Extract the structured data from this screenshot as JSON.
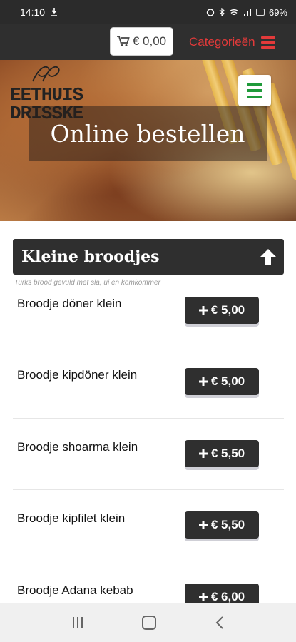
{
  "status_bar": {
    "time": "14:10",
    "battery": "69%"
  },
  "header": {
    "cart_total": "€ 0,00",
    "categories_label": "Categorieën"
  },
  "hero": {
    "logo_line1": "EETHUIS",
    "logo_line2": "DRISSKE",
    "title": "Online bestellen"
  },
  "section": {
    "title": "Kleine broodjes",
    "description": "Turks brood gevuld met sla, ui en komkommer",
    "products": [
      {
        "name": "Broodje döner klein",
        "price": "€ 5,00"
      },
      {
        "name": "Broodje kipdöner klein",
        "price": "€ 5,00"
      },
      {
        "name": "Broodje shoarma klein",
        "price": "€ 5,50"
      },
      {
        "name": "Broodje kipfilet klein",
        "price": "€ 5,50"
      },
      {
        "name": "Broodje Adana kebab",
        "price": "€ 6,00"
      }
    ]
  },
  "icons": [
    "download-icon",
    "alarm-icon",
    "bluetooth-icon",
    "wifi-icon",
    "signal-icon",
    "battery-icon",
    "cart-icon",
    "hamburger-icon",
    "arrow-up-icon",
    "plus-icon",
    "recents-icon",
    "home-icon",
    "back-icon"
  ]
}
